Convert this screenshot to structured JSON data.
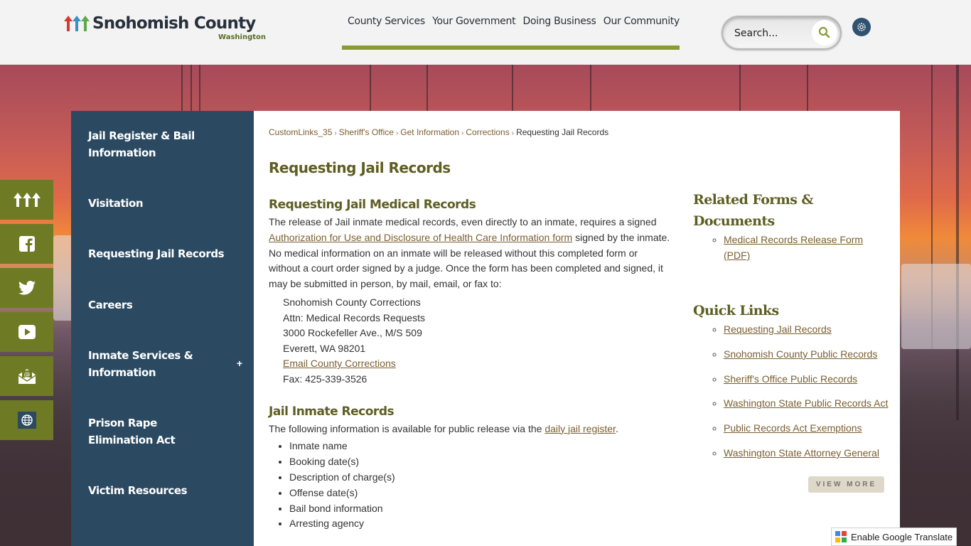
{
  "header": {
    "logo": {
      "name": "Snohomish County",
      "subtitle": "Washington"
    },
    "nav": [
      "County Services",
      "Your Government",
      "Doing Business",
      "Our Community"
    ],
    "search": {
      "placeholder": "Search...",
      "icon": "search-icon"
    },
    "settings_icon": "gear-icon"
  },
  "social": [
    {
      "name": "county-logo",
      "icon": "trees-icon"
    },
    {
      "name": "facebook",
      "icon": "facebook-icon"
    },
    {
      "name": "twitter",
      "icon": "twitter-icon"
    },
    {
      "name": "youtube",
      "icon": "youtube-icon"
    },
    {
      "name": "email",
      "icon": "email-icon"
    },
    {
      "name": "translate",
      "icon": "globe-icon"
    }
  ],
  "sidenav": {
    "items": [
      {
        "label": "Jail Register & Bail Information"
      },
      {
        "label": "Visitation"
      },
      {
        "label": "Requesting Jail Records"
      },
      {
        "label": "Careers"
      },
      {
        "label": "Inmate Services & Information",
        "expand": "+"
      },
      {
        "label": "Prison Rape Elimination Act"
      },
      {
        "label": "Victim Resources"
      }
    ]
  },
  "breadcrumb": {
    "items": [
      "CustomLinks_35",
      "Sheriff's Office",
      "Get Information",
      "Corrections"
    ],
    "separator": "›",
    "current": "Requesting Jail Records"
  },
  "page": {
    "title": "Requesting Jail Records",
    "medical": {
      "heading": "Requesting Jail Medical Records",
      "text1": "The release of Jail inmate medical records, even directly to an inmate, requires a signed ",
      "link": "Authorization for Use and Disclosure of Health Care Information form",
      "text2": " signed by the inmate. No medical information on an inmate will be released without this completed form or without a court order signed by a judge. Once the form has been completed and signed, it may be submitted in person, by mail, email, or fax to:",
      "address": [
        "Snohomish County Corrections",
        "Attn: Medical Records Requests",
        "3000 Rockefeller Ave., M/S 509",
        "Everett, WA 98201"
      ],
      "email_link": "Email County Corrections",
      "fax": "Fax: 425-339-3526"
    },
    "inmate": {
      "heading": "Jail Inmate Records",
      "text1": "The following information is available for public release via the ",
      "link": "daily jail register",
      "text2": ".",
      "items": [
        "Inmate name",
        "Booking date(s)",
        "Description of charge(s)",
        "Offense date(s)",
        "Bail bond information",
        "Arresting agency"
      ]
    }
  },
  "aside": {
    "related": {
      "title": "Related Forms & Documents",
      "links": [
        "Medical Records Release Form (PDF)"
      ]
    },
    "quick": {
      "title": "Quick Links",
      "links": [
        "Requesting Jail Records",
        "Snohomish County Public Records",
        "Sheriff's Office Public Records",
        "Washington State Public Records Act",
        "Public Records Act Exemptions",
        "Washington State Attorney General"
      ],
      "view_more": "VIEW MORE"
    }
  },
  "translate": {
    "label": "Enable Google Translate"
  },
  "colors": {
    "olive": "#6e7a24",
    "nav_bar": "#8a9a35",
    "sidebar": "#2b4a62",
    "heading": "#5e5e23",
    "link": "#7a5f30"
  }
}
